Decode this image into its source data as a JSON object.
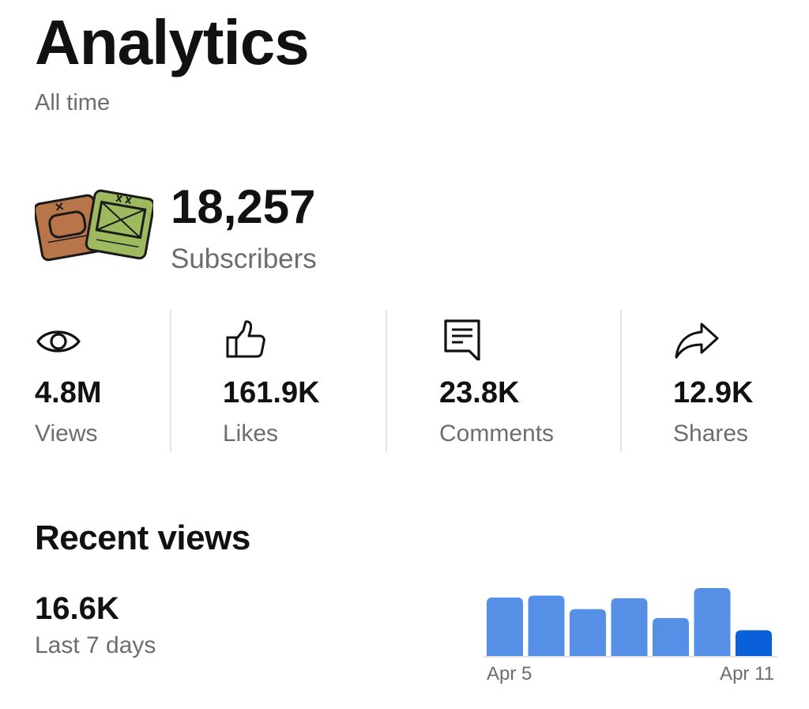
{
  "header": {
    "title": "Analytics",
    "period": "All time"
  },
  "channel": {
    "subscribers": "18,257",
    "subscribers_label": "Subscribers"
  },
  "stats": [
    {
      "icon": "eye-icon",
      "value": "4.8M",
      "label": "Views"
    },
    {
      "icon": "thumbs-up-icon",
      "value": "161.9K",
      "label": "Likes"
    },
    {
      "icon": "comment-icon",
      "value": "23.8K",
      "label": "Comments"
    },
    {
      "icon": "share-icon",
      "value": "12.9K",
      "label": "Shares"
    }
  ],
  "recent": {
    "title": "Recent views",
    "value": "16.6K",
    "label": "Last 7 days"
  },
  "colors": {
    "bar": "#5590e6",
    "bar_current": "#0a60d8",
    "muted_text": "#6d6d6d"
  },
  "chart_data": {
    "type": "bar",
    "categories": [
      "Apr 5",
      "",
      "",
      "",
      "",
      "",
      "Apr 11"
    ],
    "values": [
      0.86,
      0.89,
      0.69,
      0.85,
      0.56,
      1.0,
      0.38
    ],
    "value_scale": "relative (no axis printed)",
    "tick_labels": [
      "Apr 5",
      "Apr 11"
    ],
    "grid": false,
    "highlight_last": true
  }
}
